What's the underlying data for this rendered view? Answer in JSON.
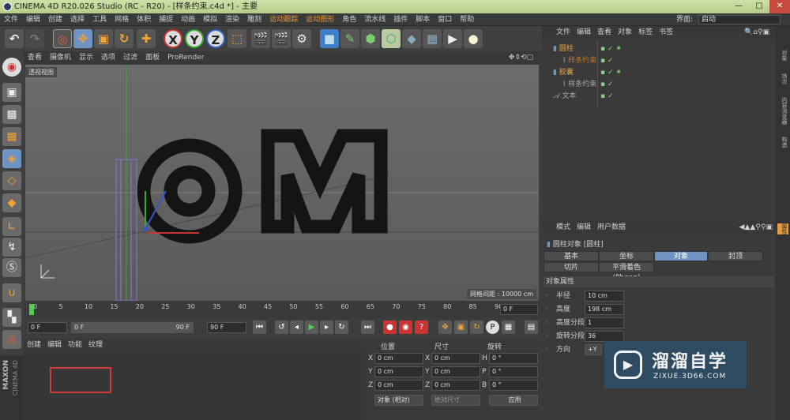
{
  "window": {
    "title": "CINEMA 4D R20.026 Studio (RC - R20) - [样条约束.c4d *] - 主要",
    "min": "—",
    "max": "□",
    "close": "✕"
  },
  "menu": {
    "items": [
      "文件",
      "编辑",
      "创建",
      "选择",
      "工具",
      "网格",
      "体积",
      "捕捉",
      "动画",
      "模拟",
      "渲染",
      "雕刻",
      "运动跟踪",
      "运动图形",
      "角色",
      "流水线",
      "插件",
      "脚本",
      "窗口",
      "帮助"
    ],
    "highlighted": [
      "运动跟踪",
      "运动图形"
    ],
    "layout_label": "界面:",
    "layout_value": "启动"
  },
  "toolbar": {
    "x": "X",
    "y": "Y",
    "z": "Z"
  },
  "viewport": {
    "menu": [
      "查看",
      "摄像机",
      "显示",
      "选项",
      "过滤",
      "面板",
      "ProRender"
    ],
    "view_name": "透视视图",
    "grid_spacing": "网格间距 : 10000 cm"
  },
  "timeline": {
    "ticks": [
      "0",
      "5",
      "10",
      "15",
      "20",
      "25",
      "30",
      "35",
      "40",
      "45",
      "50",
      "55",
      "60",
      "65",
      "70",
      "75",
      "80",
      "85",
      "90"
    ],
    "end_frame": "0 F"
  },
  "playback": {
    "start": "0 F",
    "range_start": "0 F",
    "range_end": "90 F",
    "end": "90 F"
  },
  "material": {
    "menu": [
      "创建",
      "编辑",
      "功能",
      "纹理"
    ]
  },
  "coords": {
    "headers": [
      "位置",
      "尺寸",
      "旋转"
    ],
    "rows": [
      {
        "a": "X",
        "pos": "0 cm",
        "b": "X",
        "size": "0 cm",
        "c": "H",
        "rot": "0 °"
      },
      {
        "a": "Y",
        "pos": "0 cm",
        "b": "Y",
        "size": "0 cm",
        "c": "P",
        "rot": "0 °"
      },
      {
        "a": "Z",
        "pos": "0 cm",
        "b": "Z",
        "size": "0 cm",
        "c": "B",
        "rot": "0 °"
      }
    ],
    "mode": "对象 (相对)",
    "size_mode": "绝对尺寸",
    "apply": "应用"
  },
  "objects": {
    "menu": [
      "文件",
      "编辑",
      "查看",
      "对象",
      "标签",
      "书签"
    ],
    "items": [
      {
        "name": "圆柱",
        "indent": 0,
        "color": "#e8a444"
      },
      {
        "name": "样条约束",
        "indent": 1,
        "color": "#c07830"
      },
      {
        "name": "胶囊",
        "indent": 0,
        "color": "#e8a444"
      },
      {
        "name": "样条约束",
        "indent": 1,
        "color": "#aaaaaa"
      },
      {
        "name": "文本",
        "indent": 0,
        "color": "#aaaaaa"
      }
    ]
  },
  "attributes": {
    "menu": [
      "模式",
      "编辑",
      "用户数据"
    ],
    "title": "圆柱对象 [圆柱]",
    "tabs": [
      "基本",
      "坐标",
      "对象",
      "封顶",
      "切片",
      "平滑着色(Phong)"
    ],
    "section": "对象属性",
    "props": [
      {
        "label": "半径",
        "value": "10 cm"
      },
      {
        "label": "高度",
        "value": "198 cm"
      },
      {
        "label": "高度分段",
        "value": "1"
      },
      {
        "label": "旋转分段",
        "value": "36"
      },
      {
        "label": "方向",
        "value": "+Y"
      }
    ]
  },
  "side_tabs": [
    "对象",
    "场次",
    "内容浏览器",
    "构造",
    "属性"
  ],
  "brand": {
    "maxon": "MAXON",
    "cinema": "CINEMA 4D"
  },
  "watermark": {
    "title": "溜溜自学",
    "url": "ZIXUE.3D66.COM"
  },
  "colors": {
    "accent": "#e89a3c",
    "active_tab": "#6f94c4"
  }
}
